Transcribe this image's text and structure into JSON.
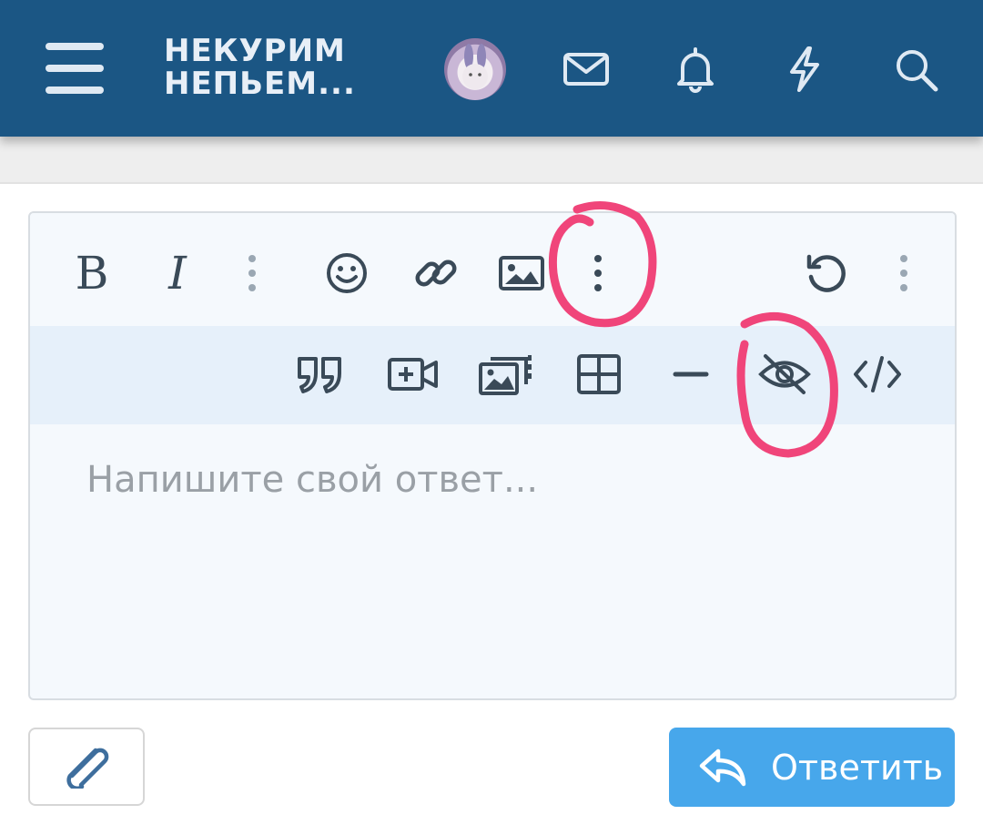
{
  "header": {
    "title_line1": "НЕКУРИМ",
    "title_line2": "НЕПЬЕМ...",
    "icons": [
      "menu-icon",
      "avatar",
      "mail-icon",
      "bell-icon",
      "lightning-icon",
      "search-icon"
    ]
  },
  "editor": {
    "toolbar_primary": [
      {
        "name": "bold",
        "glyph": "B"
      },
      {
        "name": "italic",
        "glyph": "I"
      },
      {
        "name": "more-text-options-icon"
      },
      {
        "name": "emoji-icon"
      },
      {
        "name": "link-icon"
      },
      {
        "name": "image-icon"
      },
      {
        "name": "more-insert-options-icon"
      },
      {
        "name": "undo-icon"
      },
      {
        "name": "more-options-icon"
      }
    ],
    "toolbar_secondary": [
      {
        "name": "quote-icon"
      },
      {
        "name": "media-icon"
      },
      {
        "name": "gallery-icon"
      },
      {
        "name": "table-icon"
      },
      {
        "name": "horizontal-line-icon"
      },
      {
        "name": "hide-content-icon"
      },
      {
        "name": "code-icon"
      }
    ],
    "placeholder": "Напишите свой ответ..."
  },
  "actions": {
    "attach_icon": "paperclip-icon",
    "reply_label": "Ответить",
    "reply_icon": "reply-arrow-icon"
  },
  "colors": {
    "header_bg": "#1b5684",
    "icon_light": "#dfe9f3",
    "toolbar_icon": "#3a4a58",
    "secondary_bar_bg": "#e6f0fa",
    "reply_bg": "#47a7eb",
    "annotation": "#f0457a"
  }
}
